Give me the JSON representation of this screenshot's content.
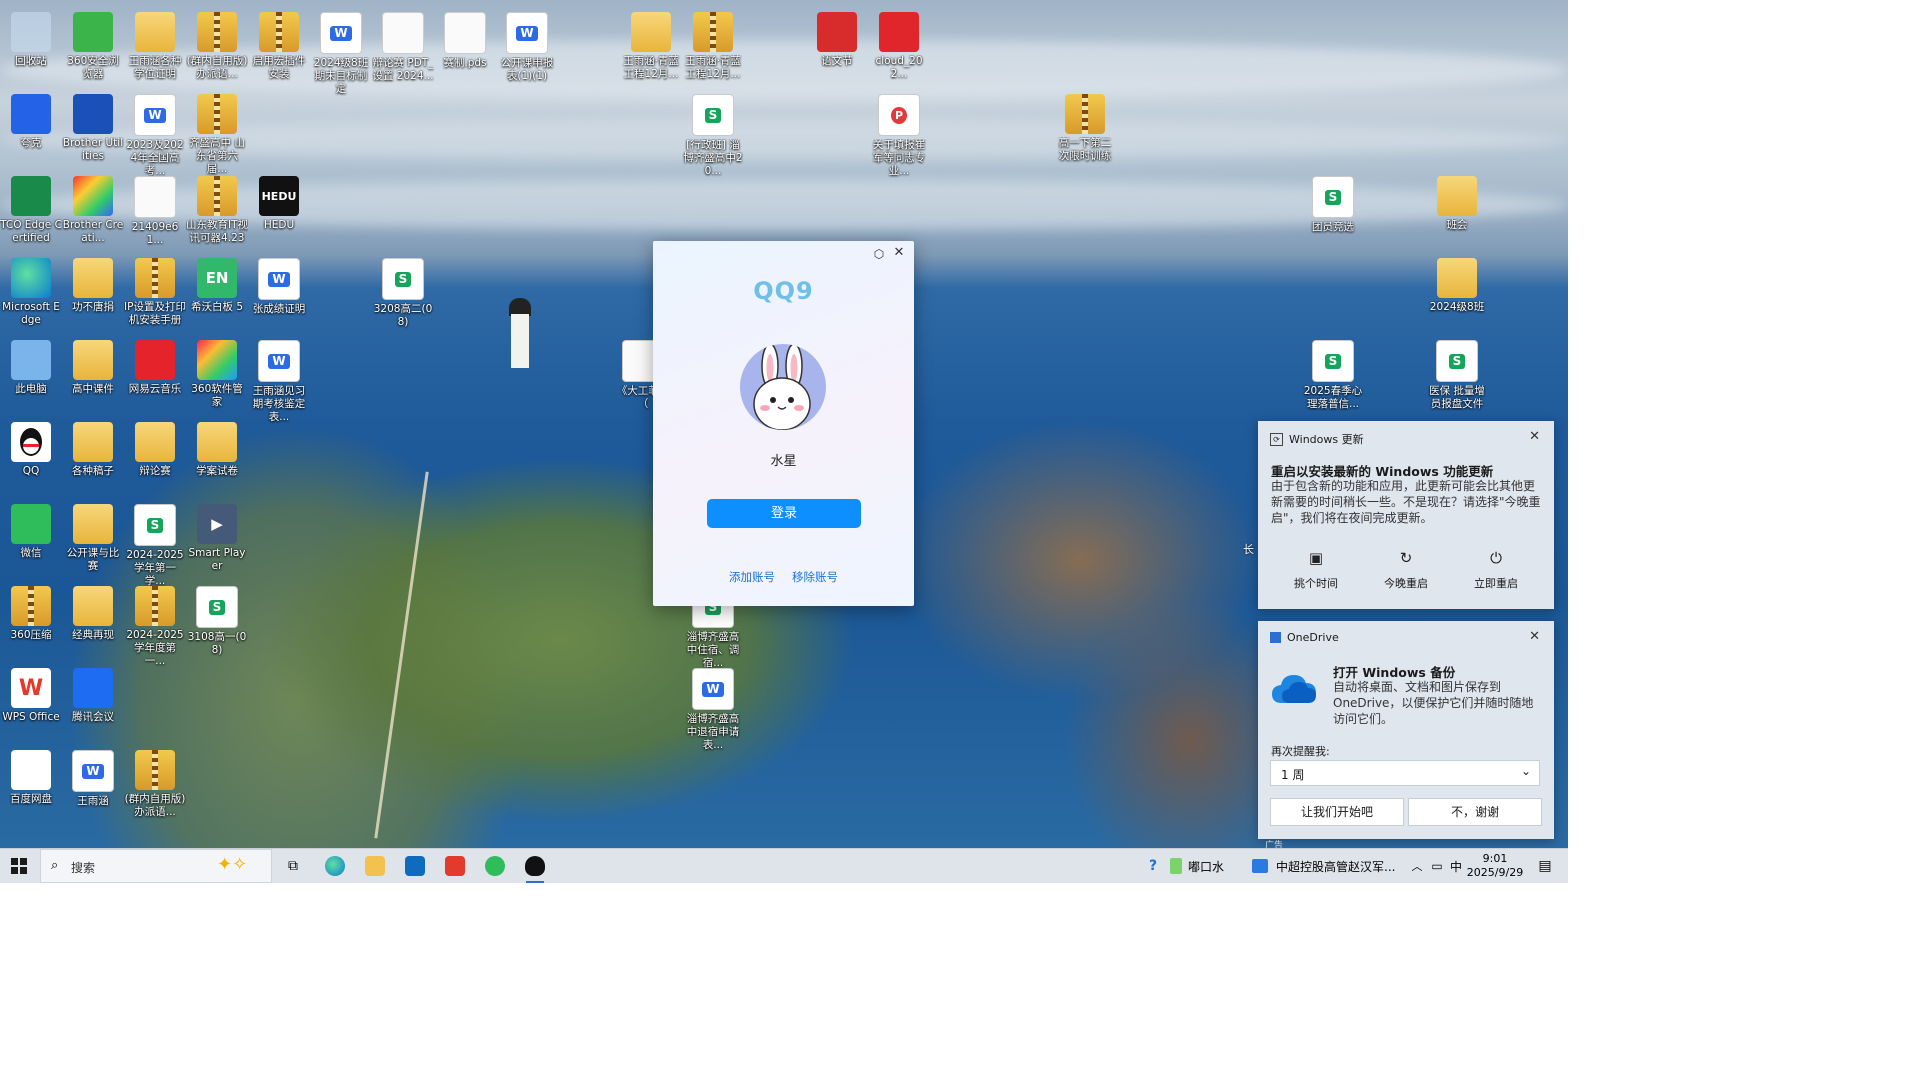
{
  "desktop": {
    "icons": [
      {
        "label": "回收站",
        "kind": "recycle"
      },
      {
        "label": "360安全浏览器",
        "kind": "e360"
      },
      {
        "label": "王雨涵各种学位证明",
        "kind": "folder"
      },
      {
        "label": "(群内自用版) 办派语...",
        "kind": "zip"
      },
      {
        "label": "启用宏插件安装",
        "kind": "zip"
      },
      {
        "label": "2024级8班期末目标制定",
        "kind": "word"
      },
      {
        "label": "辩论赛 PDT_设置 2024...",
        "kind": "plain"
      },
      {
        "label": "赛制.pds",
        "kind": "plain"
      },
      {
        "label": "公开课申报表(1)(1)",
        "kind": "word"
      },
      {
        "label": "王雨涵·青蓝工程12月...",
        "kind": "folder"
      },
      {
        "label": "王雨涵·青蓝工程12月...",
        "kind": "zip"
      },
      {
        "label": "语文节",
        "kind": "ppt"
      },
      {
        "label": "cloud_202...",
        "kind": "music"
      },
      {
        "label": "夸克",
        "kind": "quark"
      },
      {
        "label": "Brother Utilities",
        "kind": "brother"
      },
      {
        "label": "2023及2024年全国高考...",
        "kind": "word"
      },
      {
        "label": "齐盛高中 山东省第六届...",
        "kind": "zip"
      },
      {
        "label": "[行政班] 淄博齐盛高中20...",
        "kind": "sheet"
      },
      {
        "label": "关于填报崔军等同志专业...",
        "kind": "pdf"
      },
      {
        "label": "高一下第二次限时训练",
        "kind": "zip"
      },
      {
        "label": "TCO Edge Certified",
        "kind": "tco"
      },
      {
        "label": "Brother Creati...",
        "kind": "brother2"
      },
      {
        "label": "21409e61...",
        "kind": "plain"
      },
      {
        "label": "山东教育IT视讯可器4.23",
        "kind": "zip"
      },
      {
        "label": "HEDU",
        "kind": "hedu"
      },
      {
        "label": "团员竞选",
        "kind": "sheet"
      },
      {
        "label": "班会",
        "kind": "folder"
      },
      {
        "label": "Microsoft Edge",
        "kind": "edge"
      },
      {
        "label": "功不唐捐",
        "kind": "folder"
      },
      {
        "label": "IP设置及打印机安装手册",
        "kind": "zip"
      },
      {
        "label": "希沃白板 5",
        "kind": "en"
      },
      {
        "label": "张成绩证明",
        "kind": "word"
      },
      {
        "label": "3208高二(08)",
        "kind": "sheet"
      },
      {
        "label": "2024级8班",
        "kind": "folder"
      },
      {
        "label": "此电脑",
        "kind": "pc"
      },
      {
        "label": "高中课件",
        "kind": "folder"
      },
      {
        "label": "网易云音乐",
        "kind": "netease"
      },
      {
        "label": "360软件管家",
        "kind": "s360"
      },
      {
        "label": "王雨涵见习期考核鉴定表...",
        "kind": "word"
      },
      {
        "label": "《大工菲尔（",
        "kind": "plain"
      },
      {
        "label": "2025春季心理落普信...",
        "kind": "sheet"
      },
      {
        "label": "医保 批量增员报盘文件",
        "kind": "sheet"
      },
      {
        "label": "QQ",
        "kind": "qq"
      },
      {
        "label": "各种稿子",
        "kind": "folder"
      },
      {
        "label": "辩论赛",
        "kind": "folder"
      },
      {
        "label": "学案试卷",
        "kind": "folder"
      },
      {
        "label": "微信",
        "kind": "wechat"
      },
      {
        "label": "公开课与比赛",
        "kind": "folder"
      },
      {
        "label": "2024-2025学年第一学...",
        "kind": "sheet"
      },
      {
        "label": "Smart Player",
        "kind": "smart"
      },
      {
        "label": "360压缩",
        "kind": "zip"
      },
      {
        "label": "经典再现",
        "kind": "folder"
      },
      {
        "label": "2024-2025学年度第一...",
        "kind": "zip"
      },
      {
        "label": "3108高一(08)",
        "kind": "sheet"
      },
      {
        "label": "淄博齐盛高中住宿、调宿...",
        "kind": "sheet"
      },
      {
        "label": "WPS Office",
        "kind": "wps"
      },
      {
        "label": "腾讯会议",
        "kind": "meeting"
      },
      {
        "label": "淄博齐盛高中退宿申请表...",
        "kind": "word"
      },
      {
        "label": "百度网盘",
        "kind": "baidu"
      },
      {
        "label": "王雨涵",
        "kind": "word"
      },
      {
        "label": "(群内自用版) 办派语...",
        "kind": "zip"
      }
    ],
    "stray_label": "长"
  },
  "qq_window": {
    "logo": "QQ9",
    "nickname": "水星",
    "login_label": "登录",
    "add_account": "添加账号",
    "remove_account": "移除账号"
  },
  "toast_update": {
    "app": "Windows 更新",
    "title": "重启以安装最新的 Windows 功能更新",
    "body": "由于包含新的功能和应用，此更新可能会比其他更新需要的时间稍长一些。不是现在？请选择\"今晚重启\"，我们将在夜间完成更新。",
    "actions": [
      {
        "label": "挑个时间",
        "icon": "calendar-clock-icon"
      },
      {
        "label": "今晚重启",
        "icon": "moon-restart-icon"
      },
      {
        "label": "立即重启",
        "icon": "power-icon"
      }
    ]
  },
  "toast_onedrive": {
    "app": "OneDrive",
    "title": "打开 Windows 备份",
    "body": "自动将桌面、文档和图片保存到 OneDrive，以便保护它们并随时随地访问它们。",
    "remind_label": "再次提醒我:",
    "remind_value": "1 周",
    "primary": "让我们开始吧",
    "secondary": "不，谢谢",
    "ad_label": "广告"
  },
  "taskbar": {
    "search_placeholder": "搜索",
    "weather_text": "嘟口水",
    "news_text": "中超控股高管赵汉军...",
    "ime": "中",
    "time": "9:01",
    "date": "2025/9/29"
  },
  "colors": {
    "accent": "#0d8fff",
    "taskbar_bg": "#dfe3ea",
    "toast_bg": "#dfe6ee"
  }
}
